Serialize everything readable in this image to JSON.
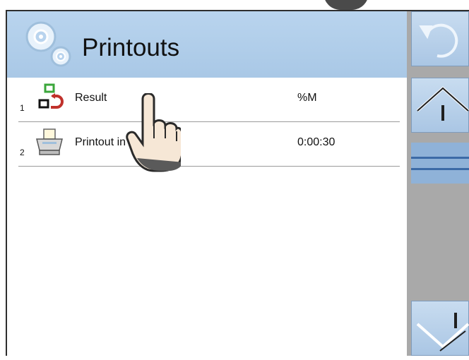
{
  "header": {
    "title": "Printouts"
  },
  "rows": [
    {
      "number": "1",
      "label": "Result",
      "value": "%M",
      "icon": "result-flag-icon"
    },
    {
      "number": "2",
      "label": "Printout in",
      "value": "0:00:30",
      "icon": "printer-icon"
    }
  ],
  "sidebar": {
    "buttons": [
      "back-arrow-icon",
      "scroll-up-icon",
      "scroll-down-icon"
    ]
  },
  "colors": {
    "header": "#b9d4ee",
    "sidebar": "#a9a9a9",
    "scroll_thumb": "#8fb2d8"
  }
}
